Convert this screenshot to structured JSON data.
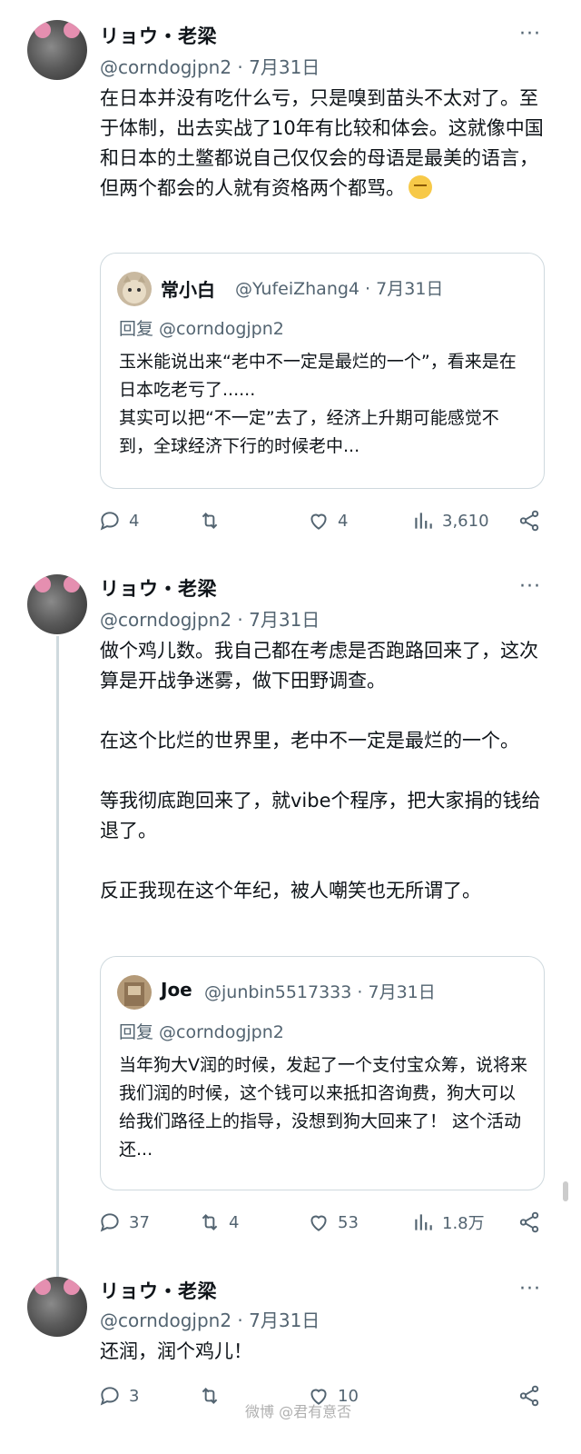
{
  "tweets": [
    {
      "author": "リョウ・老梁",
      "handle": "@corndogjpn2 · 7月31日",
      "more": "···",
      "text": "在日本并没有吃什么亏，只是嗅到苗头不太对了。至于体制，出去实战了10年有比较和体会。这就像中国和日本的土鳖都说自己仅仅会的母语是最美的语言，但两个都会的人就有资格两个都骂。",
      "quote": {
        "author": "常小白",
        "handle": "@YufeiZhang4 · 7月31日",
        "reply_to": "回复 @corndogjpn2",
        "text": "玉米能说出来“老中不一定是最烂的一个”，看来是在日本吃老亏了......\n其实可以把“不一定”去了，经济上升期可能感觉不到，全球经济下行的时候老中..."
      },
      "actions": {
        "replies": "4",
        "retweets": "",
        "likes": "4",
        "views": "3,610"
      }
    },
    {
      "author": "リョウ・老梁",
      "handle": "@corndogjpn2 · 7月31日",
      "more": "···",
      "text": "做个鸡儿数。我自己都在考虑是否跑路回来了，这次算是开战争迷雾，做下田野调查。\n\n在这个比烂的世界里，老中不一定是最烂的一个。\n\n等我彻底跑回来了，就vibe个程序，把大家捐的钱给退了。\n\n反正我现在这个年纪，被人嘲笑也无所谓了。",
      "quote": {
        "author": "Joe",
        "handle": "@junbin5517333 · 7月31日",
        "reply_to": "回复 @corndogjpn2",
        "text": "当年狗大V润的时候，发起了一个支付宝众筹，说将来我们润的时候，这个钱可以来抵扣咨询费，狗大可以给我们路径上的指导，没想到狗大回来了！ 这个活动还..."
      },
      "actions": {
        "replies": "37",
        "retweets": "4",
        "likes": "53",
        "views": "1.8万"
      }
    },
    {
      "author": "リョウ・老梁",
      "handle": "@corndogjpn2 · 7月31日",
      "more": "···",
      "text": "还润，润个鸡儿！",
      "actions": {
        "replies": "3",
        "retweets": "",
        "likes": "10",
        "views": ""
      }
    }
  ],
  "watermark": "微博 @君有意否",
  "colors": {
    "text": "#0f1419",
    "secondary": "#536471",
    "border": "#cfd9de"
  }
}
